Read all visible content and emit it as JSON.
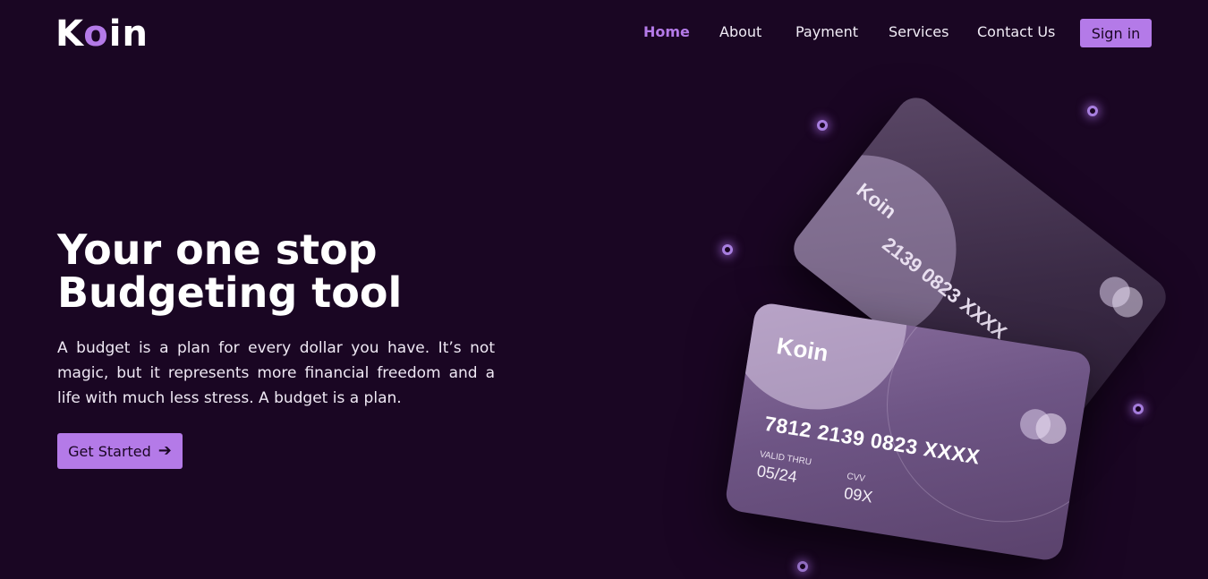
{
  "header": {
    "logo": {
      "prefix": "K",
      "accent": "o",
      "suffix": "in"
    },
    "nav": [
      {
        "label": "Home",
        "active": true
      },
      {
        "label": "About",
        "active": false
      },
      {
        "label": "Payment",
        "active": false
      },
      {
        "label": "Services",
        "active": false
      },
      {
        "label": "Contact Us",
        "active": false
      }
    ],
    "signin_label": "Sign in"
  },
  "hero": {
    "title_line1": "Your one stop",
    "title_line2": "Budgeting tool",
    "text": "A budget is a plan for every dollar you have. It’s not magic, but it represents more financial freedom and a life with much less stress. A budget is a plan.",
    "cta_label": "Get Started",
    "cta_icon": "arrow-right-icon"
  },
  "cards": {
    "front": {
      "brand": "Koin",
      "number": "7812 2139 0823 XXXX",
      "valid_label": "VALID THRU",
      "valid_value": "05/24",
      "cvv_label": "CVV",
      "cvv_value": "09X"
    },
    "back": {
      "brand": "Koin",
      "number": "2139 0823 XXXX"
    }
  },
  "colors": {
    "background": "#1a0623",
    "accent": "#b47ae8",
    "text": "#ffffff"
  }
}
